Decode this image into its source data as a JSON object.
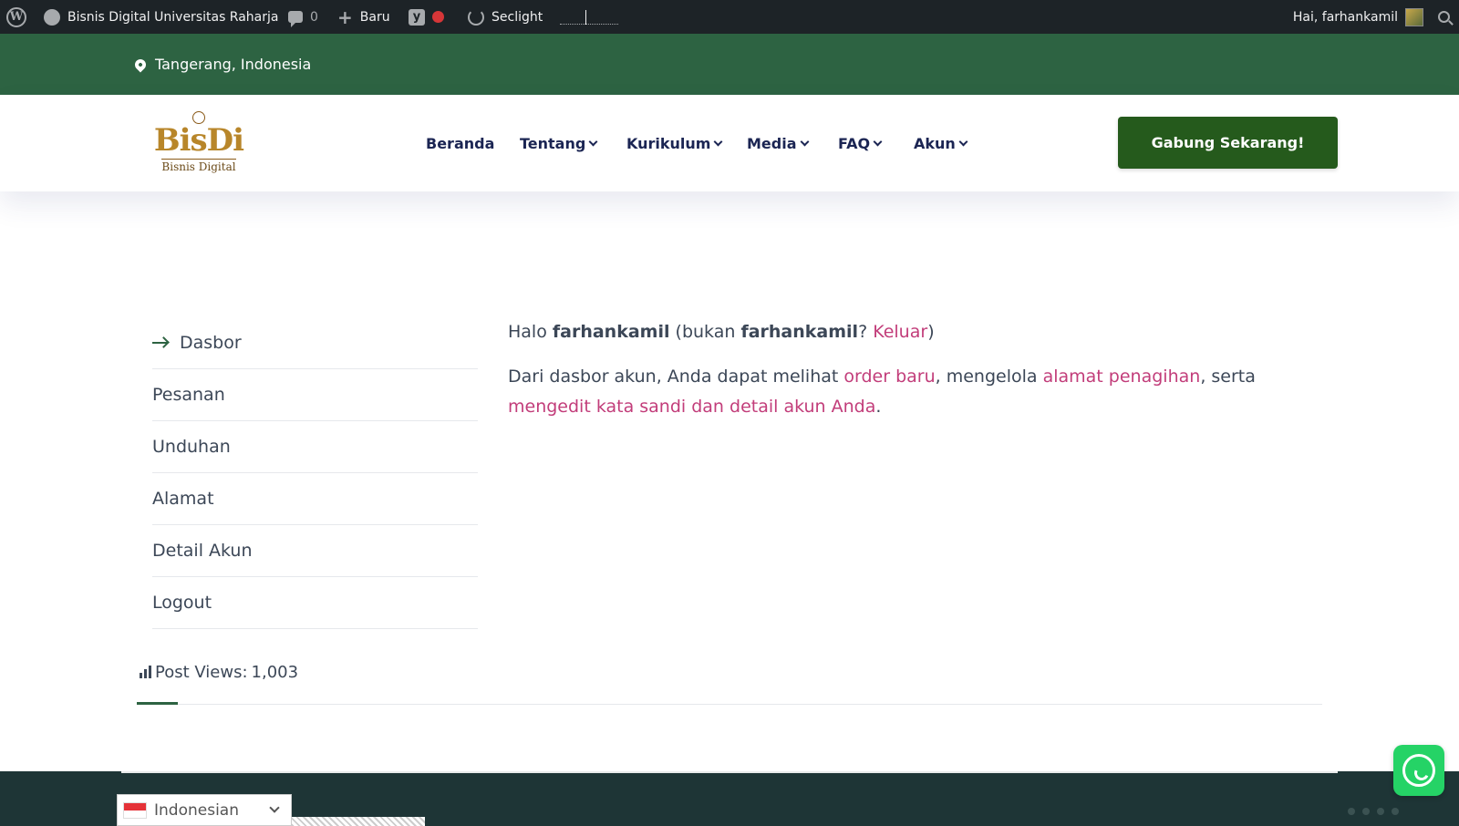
{
  "adminbar": {
    "site_name": "Bisnis Digital Universitas Raharja",
    "comments_count": "0",
    "new_label": "Baru",
    "seclight_label": "Seclight",
    "greeting": "Hai, farhankamil"
  },
  "topbar": {
    "location": "Tangerang, Indonesia"
  },
  "header": {
    "logo_big": "BisDi",
    "logo_small": "Bisnis Digital",
    "nav": [
      {
        "label": "Beranda",
        "dropdown": false
      },
      {
        "label": "Tentang",
        "dropdown": true
      },
      {
        "label": "Kurikulum",
        "dropdown": true
      },
      {
        "label": "Media",
        "dropdown": true
      },
      {
        "label": "FAQ",
        "dropdown": true
      },
      {
        "label": "Akun",
        "dropdown": true
      }
    ],
    "cta": "Gabung Sekarang!"
  },
  "account_nav": {
    "items": [
      "Dasbor",
      "Pesanan",
      "Unduhan",
      "Alamat",
      "Detail Akun",
      "Logout"
    ],
    "active": "Dasbor"
  },
  "content": {
    "hello_prefix": "Halo ",
    "username": "farhankamil",
    "not_prefix": " (bukan ",
    "not_user": "farhankamil",
    "question": "? ",
    "logout_link": "Keluar",
    "close_paren": ")",
    "p2_a": "Dari dasbor akun, Anda dapat melihat ",
    "link_orders": "order baru",
    "p2_b": ", mengelola ",
    "link_address": "alamat penagihan",
    "p2_c": ", serta ",
    "link_account": "mengedit kata sandi dan detail akun Anda",
    "p2_d": "."
  },
  "views": {
    "label": "Post Views:",
    "count": "1,003"
  },
  "language": {
    "selected": "Indonesian"
  },
  "colors": {
    "adminbar": "#1d2327",
    "topbar": "#2d6342",
    "cta": "#255a1c",
    "nav_text": "#1b2553",
    "link": "#c23d7a",
    "footer": "#1e3536",
    "whatsapp": "#25d366"
  },
  "icons": [
    "wordpress-icon",
    "dashboard-icon",
    "comment-icon",
    "plus-icon",
    "yoast-icon",
    "status-dot-icon",
    "seclight-icon",
    "avatar-icon",
    "search-icon",
    "location-pin-icon",
    "chevron-down-icon",
    "arrow-right-icon",
    "bar-chart-icon",
    "flag-icon",
    "whatsapp-icon"
  ]
}
